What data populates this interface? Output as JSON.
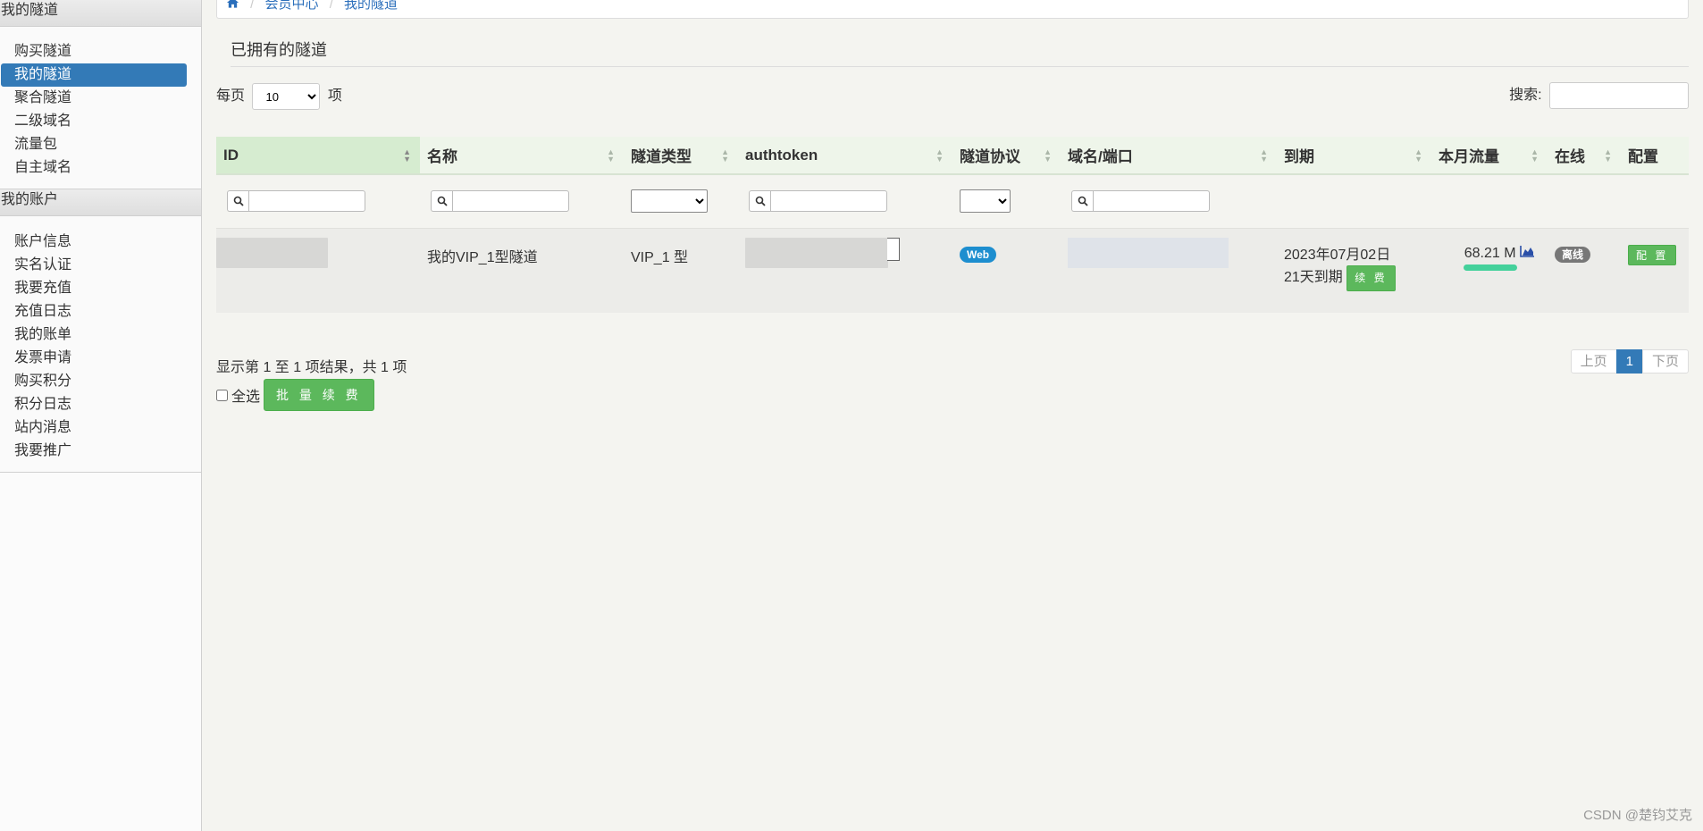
{
  "sidebar": {
    "tunnels_header": "我的隧道",
    "tunnel_items": [
      {
        "label": "购买隧道",
        "active": false
      },
      {
        "label": "我的隧道",
        "active": true
      },
      {
        "label": "聚合隧道",
        "active": false
      },
      {
        "label": "二级域名",
        "active": false
      },
      {
        "label": "流量包",
        "active": false
      },
      {
        "label": "自主域名",
        "active": false
      }
    ],
    "account_header": "我的账户",
    "account_items": [
      {
        "label": "账户信息"
      },
      {
        "label": "实名认证"
      },
      {
        "label": "我要充值"
      },
      {
        "label": "充值日志"
      },
      {
        "label": "我的账单"
      },
      {
        "label": "发票申请"
      },
      {
        "label": "购买积分"
      },
      {
        "label": "积分日志"
      },
      {
        "label": "站内消息"
      },
      {
        "label": "我要推广"
      }
    ]
  },
  "breadcrumb": {
    "home_icon": "home-icon",
    "items": [
      "会员中心",
      "我的隧道"
    ]
  },
  "section_title": "已拥有的隧道",
  "controls": {
    "per_page_label": "每页",
    "per_page_value": "10",
    "per_page_suffix": "项",
    "search_label": "搜索:",
    "search_value": ""
  },
  "table": {
    "columns": [
      "ID",
      "名称",
      "隧道类型",
      "authtoken",
      "隧道协议",
      "域名/端口",
      "到期",
      "本月流量",
      "在线",
      "配置"
    ],
    "rows": [
      {
        "name": "我的VIP_1型隧道",
        "type": "VIP_1 型",
        "protocol": "Web",
        "expiry_date": "2023年07月02日",
        "expiry_remaining": "21天到期",
        "renew_label": "续 费",
        "traffic": "68.21 M",
        "online": "离线",
        "config_label": "配 置"
      }
    ]
  },
  "footer": {
    "info": "显示第 1 至 1 项结果，共 1 项",
    "select_all": "全选",
    "batch_renew": "批 量 续 费",
    "pager": {
      "prev": "上页",
      "current": "1",
      "next": "下页"
    }
  },
  "watermark": "CSDN @楚钧艾克",
  "colors": {
    "primary": "#337ab7",
    "success": "#5cb85c",
    "header_bg": "#eef5ea"
  }
}
